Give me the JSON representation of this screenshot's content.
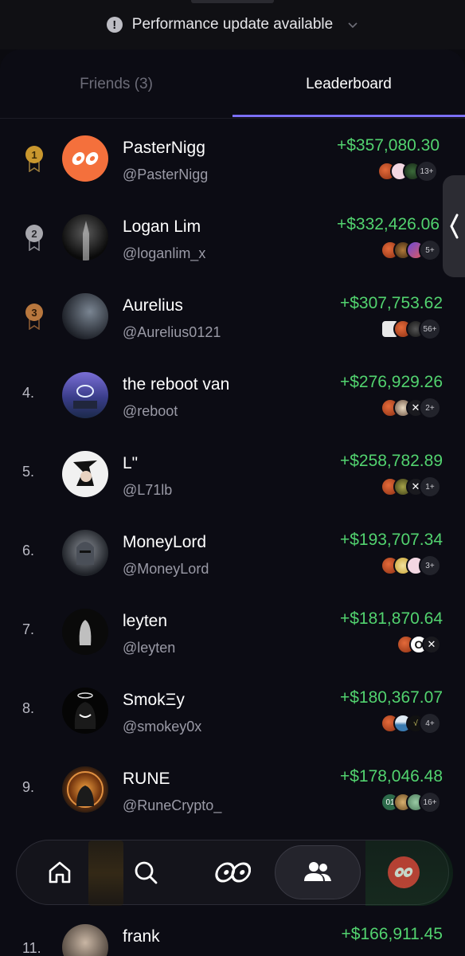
{
  "banner": {
    "text": "Performance update available"
  },
  "tabs": [
    {
      "label": "Friends (3)"
    },
    {
      "label": "Leaderboard"
    }
  ],
  "rows": [
    {
      "rank": "1",
      "name": "PasterNigg",
      "handle": "@PasterNigg",
      "amount": "+$357,080.30",
      "count": "13+"
    },
    {
      "rank": "2",
      "name": "Logan Lim",
      "handle": "@loganlim_x",
      "amount": "+$332,426.06",
      "count": "5+"
    },
    {
      "rank": "3",
      "name": "Aurelius",
      "handle": "@Aurelius0121",
      "amount": "+$307,753.62",
      "count": "56+"
    },
    {
      "rank": "4.",
      "name": "the reboot van",
      "handle": "@reboot",
      "amount": "+$276,929.26",
      "count": "2+"
    },
    {
      "rank": "5.",
      "name": "L\"",
      "handle": "@L71lb",
      "amount": "+$258,782.89",
      "count": "1+"
    },
    {
      "rank": "6.",
      "name": "MoneyLord",
      "handle": "@MoneyLord",
      "amount": "+$193,707.34",
      "count": "3+"
    },
    {
      "rank": "7.",
      "name": "leyten",
      "handle": "@leyten",
      "amount": "+$181,870.64",
      "count": ""
    },
    {
      "rank": "8.",
      "name": "SmokΞy",
      "handle": "@smokey0x",
      "amount": "+$180,367.07",
      "count": "4+"
    },
    {
      "rank": "9.",
      "name": "RUNE",
      "handle": "@RuneCrypto_",
      "amount": "+$178,046.48",
      "count": "16+"
    },
    {
      "rank": "11.",
      "name": "frank",
      "handle": "",
      "amount": "+$166,911.45",
      "count": ""
    }
  ],
  "nav": [
    {
      "icon": "home-icon"
    },
    {
      "icon": "search-icon"
    },
    {
      "icon": "app-logo-icon"
    },
    {
      "icon": "users-icon"
    },
    {
      "icon": "profile-avatar"
    }
  ],
  "colors": {
    "accent": "#7b6ff6",
    "gain": "#52d36f",
    "background": "#0c0c14"
  }
}
